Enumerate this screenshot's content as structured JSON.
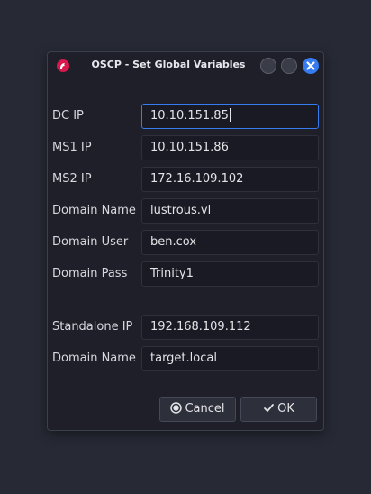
{
  "dialog": {
    "title": "OSCP - Set Global Variables"
  },
  "fields": [
    {
      "label": "DC IP",
      "value": "10.10.151.85"
    },
    {
      "label": "MS1 IP",
      "value": "10.10.151.86"
    },
    {
      "label": "MS2 IP",
      "value": "172.16.109.102"
    },
    {
      "label": "Domain Name",
      "value": "lustrous.vl"
    },
    {
      "label": "Domain User",
      "value": "ben.cox"
    },
    {
      "label": "Domain Pass",
      "value": "Trinity1"
    },
    {
      "label": "Standalone IP",
      "value": "192.168.109.112"
    },
    {
      "label": "Domain Name",
      "value": "target.local"
    }
  ],
  "buttons": {
    "cancel_label": "Cancel",
    "ok_label": "OK"
  },
  "icons": {
    "app": "kali-dragon-icon",
    "cancel": "cancel-circle-icon",
    "ok": "checkmark-icon",
    "close": "close-icon"
  },
  "colors": {
    "accent": "#367bf0",
    "app_icon": "#d8174c"
  }
}
